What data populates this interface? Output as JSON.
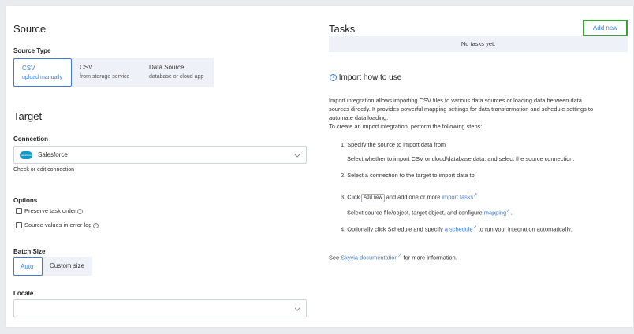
{
  "source": {
    "title": "Source",
    "type_label": "Source Type",
    "types": [
      {
        "name": "CSV",
        "sub": "upload manually"
      },
      {
        "name": "CSV",
        "sub": "from storage service"
      },
      {
        "name": "Data Source",
        "sub": "database or cloud app"
      }
    ]
  },
  "target": {
    "title": "Target",
    "connection_label": "Connection",
    "connection_value": "Salesforce",
    "connection_logo_text": "salesforce",
    "check_link": "Check or edit connection"
  },
  "options": {
    "label": "Options",
    "preserve_order": "Preserve task order",
    "source_values": "Source values in error log"
  },
  "batch": {
    "label": "Batch Size",
    "auto": "Auto",
    "custom": "Custom size"
  },
  "locale": {
    "label": "Locale",
    "value": ""
  },
  "tasks": {
    "title": "Tasks",
    "add_new": "Add new",
    "empty": "No tasks yet."
  },
  "howto": {
    "title": "Import how to use",
    "intro_1": "Import integration allows importing CSV files to various data sources or loading data between data",
    "intro_2": "sources directly. It provides powerful mapping settings for data transformation and schedule settings to",
    "intro_3": "automate data loading.",
    "intro_4": "To create an import integration, perform the following steps:",
    "step1": "1. Specify the source to import data from",
    "step1_sub": "Select whether to import CSV or cloud/database data, and select the source connection.",
    "step2": "2. Select a connection to the target to import data to.",
    "step3_a": "3. Click",
    "step3_btn": "Add new",
    "step3_b": "and add one or more",
    "step3_link": "import tasks",
    "step3_sub_a": "Select source file/object, target object, and configure",
    "step3_sub_link": "mapping",
    "step3_sub_end": ".",
    "step4_a": "4. Optionally click Schedule and specify",
    "step4_link": "a schedule",
    "step4_b": "to run your integration automatically.",
    "see_a": "See",
    "see_link": "Skyvia documentation",
    "see_b": "for more information."
  }
}
